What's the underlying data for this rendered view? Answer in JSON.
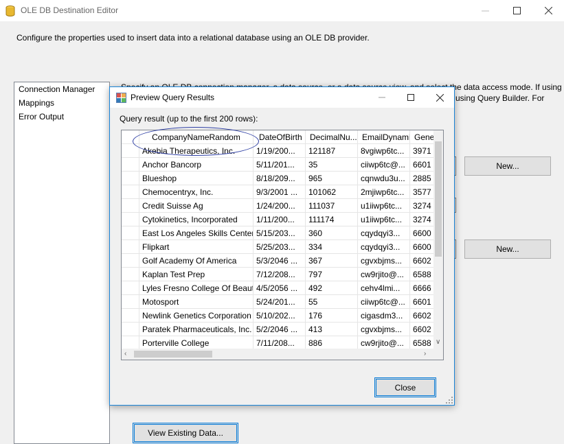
{
  "window": {
    "title": "OLE DB Destination Editor",
    "description": "Configure the properties used to insert data into a relational database using an OLE DB provider."
  },
  "nav": {
    "items": [
      {
        "label": "Connection Manager"
      },
      {
        "label": "Mappings"
      },
      {
        "label": "Error Output"
      }
    ]
  },
  "connection_page": {
    "specify_text_line1": "Specify an OLE DB connection manager, a data source, or a data source view, and select the data access mode. If using",
    "specify_text_line2": "using Query Builder. For",
    "new_button_1": "New...",
    "new_button_2": "New...",
    "view_existing_button": "View Existing Data..."
  },
  "dialog": {
    "title": "Preview Query Results",
    "query_label": "Query result (up to the first 200 rows):",
    "close_button": "Close",
    "columns": [
      "CompanyNameRandom",
      "DateOfBirth",
      "DecimalNu...",
      "EmailDynamic",
      "Gene"
    ],
    "rows": [
      [
        "Akebia Therapeutics, Inc.",
        "1/19/200...",
        "121187",
        "8vgiwp6tc...",
        "3971"
      ],
      [
        "Anchor Bancorp",
        "5/11/201...",
        "35",
        "ciiwp6tc@...",
        "6601"
      ],
      [
        "Blueshop",
        "8/18/209...",
        "965",
        "cqnwdu3u...",
        "2885"
      ],
      [
        "Chemocentryx, Inc.",
        "9/3/2001 ...",
        "101062",
        "2mjiwp6tc...",
        "3577"
      ],
      [
        "Credit Suisse Ag",
        "1/24/200...",
        "111037",
        "u1iiwp6tc...",
        "3274"
      ],
      [
        "Cytokinetics, Incorporated",
        "1/11/200...",
        "111174",
        "u1iiwp6tc...",
        "3274"
      ],
      [
        "East Los Angeles Skills Center",
        "5/15/203...",
        "360",
        "cqydqyi3...",
        "6600"
      ],
      [
        "Flipkart",
        "5/25/203...",
        "334",
        "cqydqyi3...",
        "6600"
      ],
      [
        "Golf Academy Of America",
        "5/3/2046 ...",
        "367",
        "cgvxbjms...",
        "6602"
      ],
      [
        "Kaplan Test Prep",
        "7/12/208...",
        "797",
        "cw9rjito@...",
        "6588"
      ],
      [
        "Lyles Fresno College Of Beauty",
        "4/5/2056 ...",
        "492",
        "cehv4lmi...",
        "6666"
      ],
      [
        "Motosport",
        "5/24/201...",
        "55",
        "ciiwp6tc@...",
        "6601"
      ],
      [
        "Newlink Genetics Corporation",
        "5/10/202...",
        "176",
        "cigasdm3...",
        "6602"
      ],
      [
        "Paratek Pharmaceuticals, Inc.",
        "5/2/2046 ...",
        "413",
        "cgvxbjms...",
        "6602"
      ],
      [
        "Porterville College",
        "7/11/208...",
        "886",
        "cw9rjito@...",
        "6588"
      ]
    ]
  },
  "colors": {
    "accent": "#0078d7",
    "annotation": "#2b3ca3",
    "window_bg": "#f0f0f0"
  }
}
